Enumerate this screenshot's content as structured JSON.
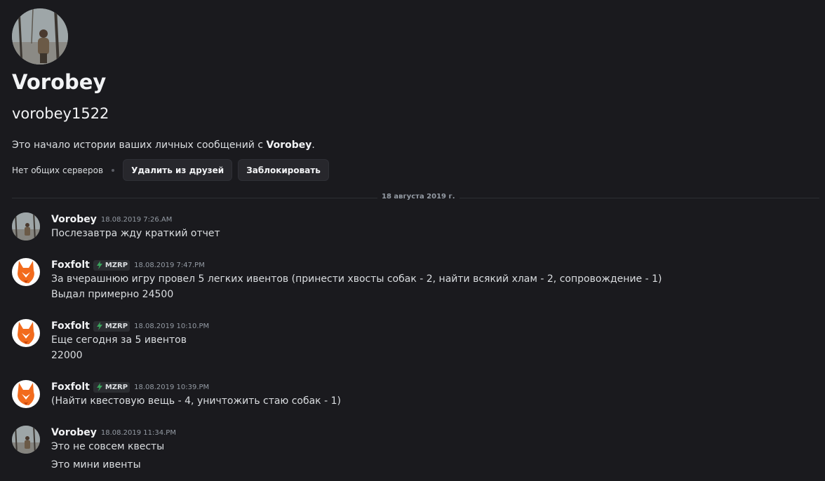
{
  "profile": {
    "display_name": "Vorobey",
    "username": "vorobey1522",
    "intro_prefix": "Это начало истории ваших личных сообщений с ",
    "intro_name": "Vorobey",
    "intro_suffix": ".",
    "mutual_servers": "Нет общих серверов",
    "remove_friend_label": "Удалить из друзей",
    "block_label": "Заблокировать"
  },
  "divider": {
    "label": "18 августа 2019 г."
  },
  "messages": [
    {
      "author": "Vorobey",
      "tag": "",
      "time": "18.08.2019 7:26.AM",
      "lines": [
        "Послезавтра жду краткий отчет"
      ]
    },
    {
      "author": "Foxfolt",
      "tag": "MZRP",
      "time": "18.08.2019 7:47.PM",
      "lines": [
        "За вчерашнюю игру провел 5 легких ивентов (принести хвосты собак - 2, найти всякий хлам - 2, сопровождение - 1)",
        "Выдал  примерно 24500"
      ]
    },
    {
      "author": "Foxfolt",
      "tag": "MZRP",
      "time": "18.08.2019 10:10.PM",
      "lines": [
        "Еще сегодня за 5 ивентов",
        "22000"
      ]
    },
    {
      "author": "Foxfolt",
      "tag": "MZRP",
      "time": "18.08.2019 10:39.PM",
      "lines": [
        "(Найти квестовую вещь - 4, уничтожить стаю собак - 1)"
      ]
    },
    {
      "author": "Vorobey",
      "tag": "",
      "time": "18.08.2019 11:34.PM",
      "lines": [
        "Это не совсем квесты",
        "Это мини ивенты"
      ]
    }
  ],
  "colors": {
    "background": "#1a1a1e",
    "tag_icon": "#3ba55d",
    "fox_orange": "#f26b1d"
  }
}
